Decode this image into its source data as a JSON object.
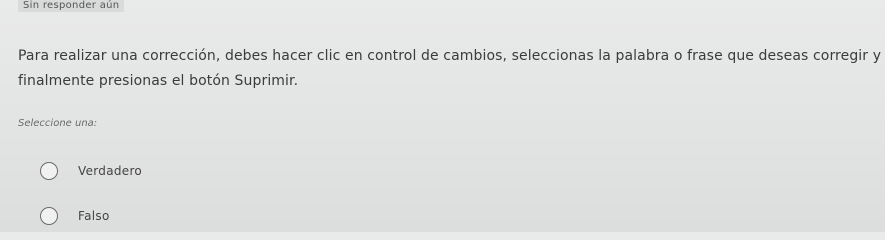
{
  "status": "Sin responder aún",
  "question": {
    "text": "Para realizar una corrección, debes hacer clic en control de cambios, seleccionas la palabra o frase que deseas corregir y finalmente presionas el botón Suprimir."
  },
  "prompt": "Seleccione una:",
  "options": [
    {
      "label": "Verdadero",
      "selected": false
    },
    {
      "label": "Falso",
      "selected": false
    }
  ]
}
